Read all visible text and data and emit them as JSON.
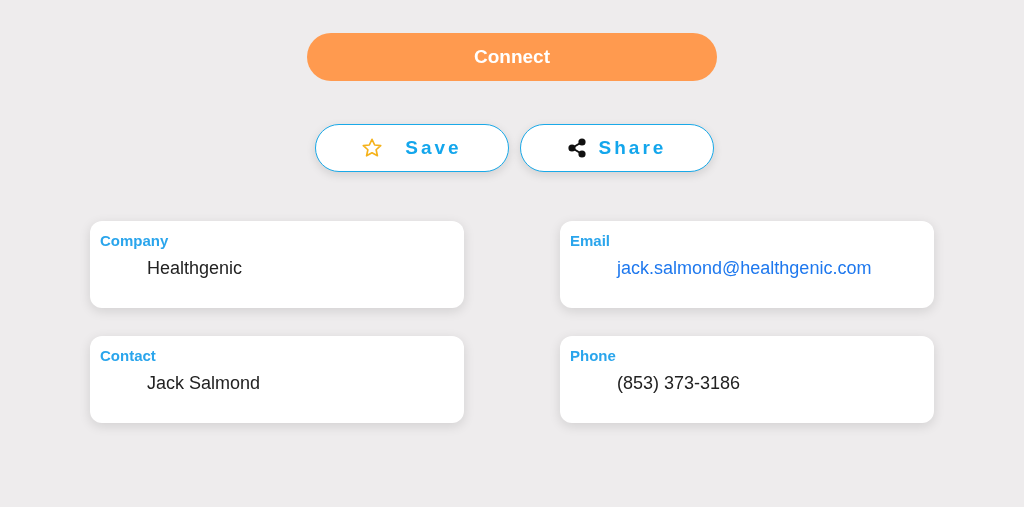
{
  "primary_button": {
    "label": "Connect"
  },
  "actions": [
    {
      "kind": "star",
      "label": "Save"
    },
    {
      "kind": "share",
      "label": "Share"
    }
  ],
  "fields": [
    {
      "label": "Company",
      "value": "Healthgenic",
      "kind": "text"
    },
    {
      "label": "Email",
      "value": "jack.salmond@healthgenic.com",
      "kind": "link"
    },
    {
      "label": "Contact",
      "value": "Jack Salmond",
      "kind": "text"
    },
    {
      "label": "Phone",
      "value": "(853) 373-3186",
      "kind": "text"
    }
  ]
}
